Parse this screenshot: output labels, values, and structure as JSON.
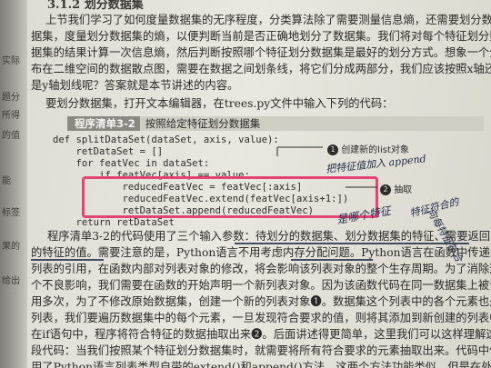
{
  "section": {
    "number": "3.1.2",
    "title": "划分数据集"
  },
  "left_margin_fragments": [
    "实际",
    "题分",
    "所得",
    "的值",
    "能",
    "标签",
    "果的",
    "给出"
  ],
  "intro_lines": [
    "上节我们学习了如何度量数据集的无序程度，分类算法除了需要测量信息熵，还需要划分数",
    "据集，度量划分数据集的熵，以便判断当前是否正确地划分了数据集。我们将对每个特征划分数",
    "据集的结果计算一次信息熵，然后判断按照哪个特征划分数据集是最好的划分方式。想象一个分",
    "布在二维空间的数据散点图，需要在数据之间划条线，将它们分成两部分，我们应该按照x轴还",
    "是y轴划线呢？答案就是本节讲述的内容。",
    "要划分数据集，打开文本编辑器，在trees.py文件中输入下列的代码："
  ],
  "listing": {
    "label": "程序清单3-2",
    "title": "按照给定特征划分数据集"
  },
  "code_lines": [
    "def splitDataSet(dataSet, axis, value):",
    "    retDataSet = []",
    "    for featVec in dataSet:",
    "        if featVec[axis] == value:",
    "            reducedFeatVec = featVec[:axis]",
    "            reducedFeatVec.extend(featVec[axis+1:])",
    "            retDataSet.append(reducedFeatVec)",
    "    return retDataSet"
  ],
  "callouts": [
    {
      "num": "1",
      "text": "创建新的list对象"
    },
    {
      "num": "2",
      "text": "抽取"
    }
  ],
  "handwritten": {
    "note_a": "把特征值加入 append",
    "note_b": "是哪个特征",
    "note_c": "特征符合的",
    "note_d": "向每特征符合"
  },
  "body_lines": [
    "程序清单3-2的代码使用了三个输入参数：待划分的数据集、划分数据集的特征、需要返回",
    "的特征的值。需要注意的是，Python语言不用考虑内存分配问题。Python语言在函数中传递的是",
    "列表的引用，在函数内部对列表对象的修改，将会影响该列表对象的整个生存周期。为了消除这",
    "个不良影响，我们需要在函数的开始声明一个新列表对象。因为该函数代码在同一数据集上被调",
    "用多次，为了不修改原始数据集，创建一个新的列表对象❶。数据集这个列表中的各个元素也是",
    "列表，我们要遍历数据集中的每个元素，一旦发现符合要求的值，则将其添加到新创建的列表中。",
    "在if语句中，程序将符合特征的数据抽取出来❷。后面讲述得更简单，这里我们可以这样理解这",
    "段代码：当我们按照某个特征划分数据集时，就需要将所有符合要求的元素抽取出来。代码中使",
    "用了Python语言列表类型自带的extend()和append()方法。这两个方法功能类似，但是在处理"
  ]
}
